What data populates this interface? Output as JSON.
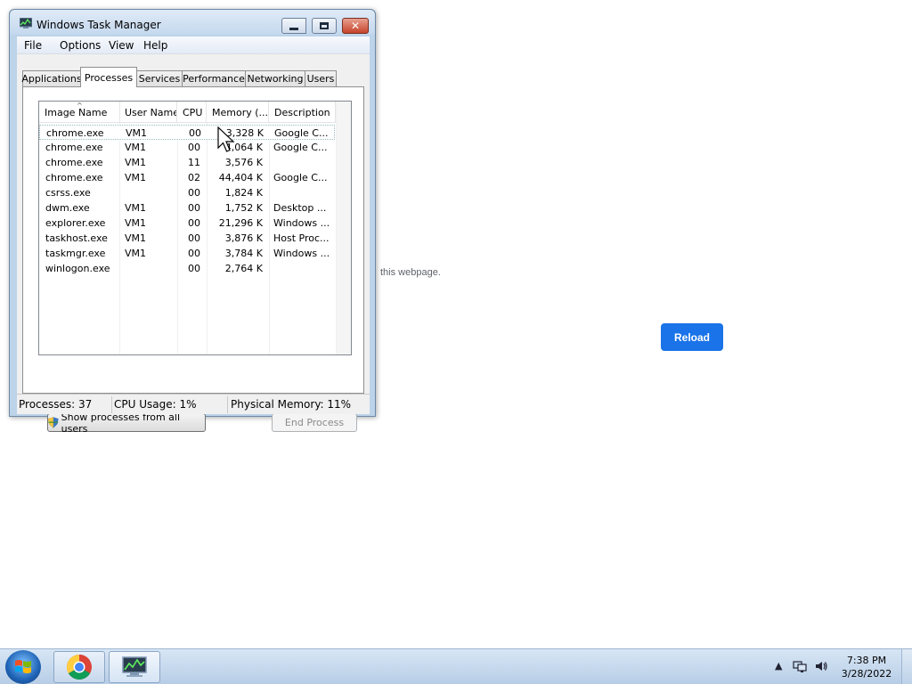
{
  "browser_bg": {
    "message_fragment": "this webpage.",
    "reload_label": "Reload"
  },
  "window": {
    "title": "Windows Task Manager",
    "menu": [
      "File",
      "Options",
      "View",
      "Help"
    ],
    "tabs": [
      "Applications",
      "Processes",
      "Services",
      "Performance",
      "Networking",
      "Users"
    ],
    "active_tab": "Processes",
    "columns": [
      "Image Name",
      "User Name",
      "CPU",
      "Memory (...",
      "Description"
    ],
    "processes": [
      {
        "name": "chrome.exe",
        "user": "VM1",
        "cpu": "00",
        "mem": "3,328 K",
        "desc": "Google C..."
      },
      {
        "name": "chrome.exe",
        "user": "VM1",
        "cpu": "00",
        "mem": "4,064 K",
        "desc": "Google C..."
      },
      {
        "name": "chrome.exe",
        "user": "VM1",
        "cpu": "11",
        "mem": "3,576 K",
        "desc": ""
      },
      {
        "name": "chrome.exe",
        "user": "VM1",
        "cpu": "02",
        "mem": "44,404 K",
        "desc": "Google C..."
      },
      {
        "name": "csrss.exe",
        "user": "",
        "cpu": "00",
        "mem": "1,824 K",
        "desc": ""
      },
      {
        "name": "dwm.exe",
        "user": "VM1",
        "cpu": "00",
        "mem": "1,752 K",
        "desc": "Desktop ..."
      },
      {
        "name": "explorer.exe",
        "user": "VM1",
        "cpu": "00",
        "mem": "21,296 K",
        "desc": "Windows ..."
      },
      {
        "name": "taskhost.exe",
        "user": "VM1",
        "cpu": "00",
        "mem": "3,876 K",
        "desc": "Host Proc..."
      },
      {
        "name": "taskmgr.exe",
        "user": "VM1",
        "cpu": "00",
        "mem": "3,784 K",
        "desc": "Windows ..."
      },
      {
        "name": "winlogon.exe",
        "user": "",
        "cpu": "00",
        "mem": "2,764 K",
        "desc": ""
      }
    ],
    "show_all_label": "Show processes from all users",
    "end_process_label": "End Process",
    "status": {
      "processes": "Processes: 37",
      "cpu": "CPU Usage: 1%",
      "memory": "Physical Memory: 11%"
    }
  },
  "taskbar": {
    "apps": [
      "start-orb-icon",
      "chrome-icon",
      "task-manager-icon"
    ],
    "time": "7:38 PM",
    "date": "3/28/2022"
  },
  "colors": {
    "accent": "#1a73e8",
    "window_frame": "#bcd3ea",
    "close_button": "#c6432a"
  }
}
